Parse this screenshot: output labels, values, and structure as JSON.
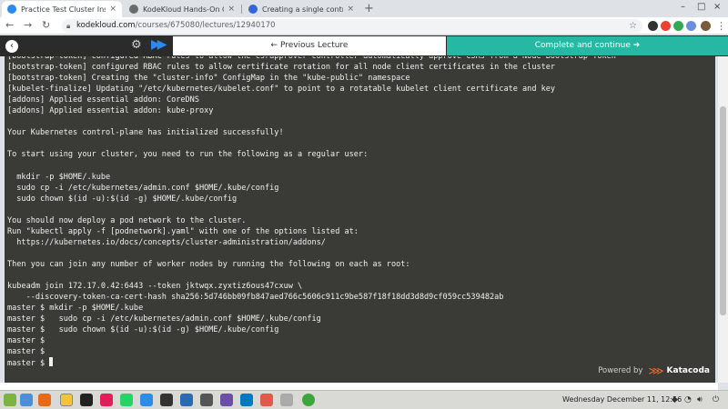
{
  "browser": {
    "tabs": [
      {
        "label": "Practice Test Cluster Installat",
        "fav_color": "#2a8af2"
      },
      {
        "label": "KodeKloud Hands-On Quiz",
        "fav_color": "#6b6b6b"
      },
      {
        "label": "Creating a single control-plan",
        "fav_color": "#3367d6"
      }
    ],
    "tab_close": "×",
    "new_tab": "+",
    "window_controls": [
      "–",
      "□",
      "×"
    ],
    "url_domain": "kodekloud.com",
    "url_path": "/courses/675080/lectures/12940170"
  },
  "course_bar": {
    "prev_label": "Previous Lecture",
    "prev_arrow": "←",
    "complete_label": "Complete and continue",
    "complete_arrow": "➔"
  },
  "terminal": {
    "lines": [
      "[bootstrap-token] configured RBAC rules to allow the csrapprover controller automatically approve CSRs from a Node Bootstrap Token",
      "[bootstrap-token] configured RBAC rules to allow certificate rotation for all node client certificates in the cluster",
      "[bootstrap-token] Creating the \"cluster-info\" ConfigMap in the \"kube-public\" namespace",
      "[kubelet-finalize] Updating \"/etc/kubernetes/kubelet.conf\" to point to a rotatable kubelet client certificate and key",
      "[addons] Applied essential addon: CoreDNS",
      "[addons] Applied essential addon: kube-proxy",
      "",
      "Your Kubernetes control-plane has initialized successfully!",
      "",
      "To start using your cluster, you need to run the following as a regular user:",
      "",
      "  mkdir -p $HOME/.kube",
      "  sudo cp -i /etc/kubernetes/admin.conf $HOME/.kube/config",
      "  sudo chown $(id -u):$(id -g) $HOME/.kube/config",
      "",
      "You should now deploy a pod network to the cluster.",
      "Run \"kubectl apply -f [podnetwork].yaml\" with one of the options listed at:",
      "  https://kubernetes.io/docs/concepts/cluster-administration/addons/",
      "",
      "Then you can join any number of worker nodes by running the following on each as root:",
      "",
      "kubeadm join 172.17.0.42:6443 --token jktwqx.zyxtiz6ous47cxuw \\",
      "    --discovery-token-ca-cert-hash sha256:5d746bb09fb847aed766c5606c911c9be587f18f18dd3d8d9cf059cc539482ab",
      "master $ mkdir -p $HOME/.kube",
      "master $   sudo cp -i /etc/kubernetes/admin.conf $HOME/.kube/config",
      "master $   sudo chown $(id -u):$(id -g) $HOME/.kube/config",
      "master $",
      "master $",
      "master $ "
    ],
    "powered_by": "Powered by",
    "brand": "Katacoda"
  },
  "taskbar": {
    "clock": "Wednesday December 11, 12:56"
  }
}
